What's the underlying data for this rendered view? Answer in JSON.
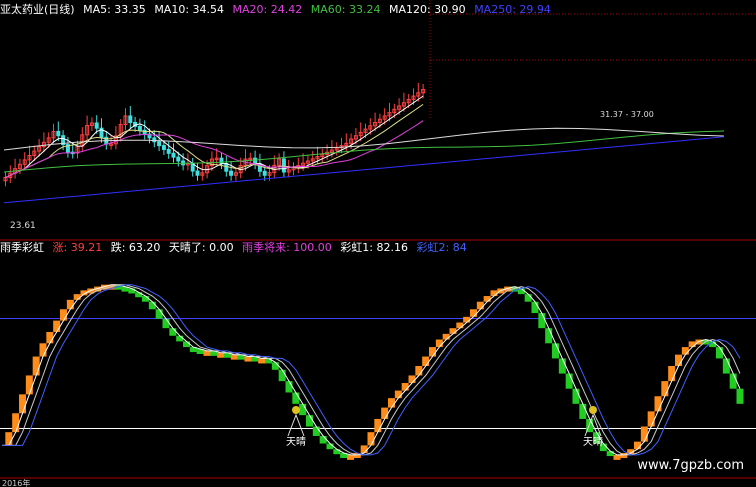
{
  "top_legend": {
    "name": "亚太药业(日线)",
    "items": [
      {
        "label": "MA5: 33.35",
        "color": "#ffffff"
      },
      {
        "label": "MA10: 34.54",
        "color": "#ffffff"
      },
      {
        "label": "MA20: 24.42",
        "color": "#e040e0"
      },
      {
        "label": "MA60: 33.24",
        "color": "#40c040"
      },
      {
        "label": "MA120: 30.90",
        "color": "#ffffff"
      },
      {
        "label": "MA250: 29.94",
        "color": "#4040ff"
      }
    ]
  },
  "bottom_legend": {
    "name": "雨季彩虹",
    "items": [
      {
        "label": "涨: 39.21",
        "color": "#ff4040"
      },
      {
        "label": "跌: 63.20",
        "color": "#ffffff"
      },
      {
        "label": "天晴了: 0.00",
        "color": "#ffffff"
      },
      {
        "label": "雨季将来: 100.00",
        "color": "#e040e0"
      },
      {
        "label": "彩虹1: 82.16",
        "color": "#ffffff"
      },
      {
        "label": "彩虹2: 84",
        "color": "#4060ff"
      }
    ]
  },
  "price_annotations": {
    "low": "23.61",
    "range": "31.37 - 37.00"
  },
  "signal_labels": [
    "天晴",
    "天晴"
  ],
  "date_label": "2016年",
  "watermark": "www.7gpzb.com",
  "colors": {
    "rise": "#ff8c1a",
    "fall": "#22cc22",
    "candle_up": "#ff4040",
    "candle_down": "#40e0e0",
    "grid_red": "#aa0000",
    "level_line": "#4040ff",
    "zero_line": "#ffffff"
  },
  "chart_data": [
    {
      "type": "candlestick",
      "title": "亚太药业(日线)",
      "ylim": [
        22,
        40
      ],
      "moving_averages": [
        "MA5",
        "MA10",
        "MA20",
        "MA60",
        "MA120",
        "MA250"
      ]
    },
    {
      "type": "bar",
      "title": "雨季彩虹",
      "ylim": [
        -5,
        105
      ],
      "levels": [
        0,
        100
      ],
      "series": [
        {
          "name": "涨",
          "color": "#ff8c1a"
        },
        {
          "name": "跌",
          "color": "#22cc22"
        },
        {
          "name": "彩虹1",
          "color": "#ffffff"
        },
        {
          "name": "彩虹2",
          "color": "#4060ff"
        }
      ],
      "oscillator_values": [
        8,
        15,
        25,
        35,
        45,
        55,
        62,
        68,
        74,
        80,
        85,
        88,
        90,
        91,
        92,
        93,
        93,
        92,
        91,
        89,
        87,
        84,
        80,
        75,
        70,
        66,
        63,
        60,
        59,
        58,
        58,
        57,
        57,
        56,
        56,
        55,
        55,
        54,
        54,
        52,
        48,
        42,
        36,
        30,
        24,
        18,
        13,
        9,
        6,
        4,
        3,
        3,
        4,
        8,
        15,
        22,
        28,
        33,
        37,
        41,
        45,
        50,
        55,
        60,
        64,
        67,
        70,
        73,
        76,
        80,
        84,
        87,
        90,
        91,
        92,
        91,
        88,
        84,
        78,
        70,
        62,
        54,
        46,
        38,
        30,
        22,
        15,
        9,
        5,
        3,
        3,
        4,
        6,
        10,
        18,
        26,
        34,
        42,
        50,
        56,
        60,
        63,
        64,
        63,
        60,
        54,
        46,
        38,
        30
      ]
    }
  ]
}
